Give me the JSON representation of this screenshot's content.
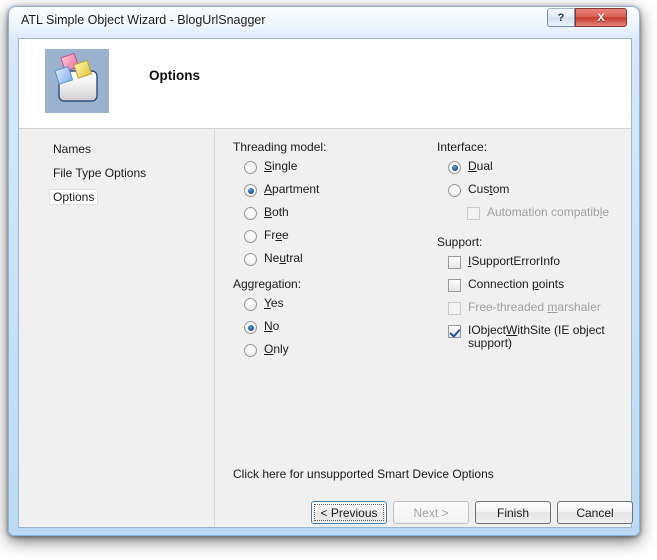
{
  "window": {
    "title": "ATL Simple Object Wizard - BlogUrlSnagger",
    "help_button": "?",
    "close_button": "X"
  },
  "header": {
    "title": "Options",
    "icon": "wizard-object-icon"
  },
  "sidebar": {
    "items": [
      {
        "label": "Names",
        "selected": false
      },
      {
        "label": "File Type Options",
        "selected": false
      },
      {
        "label": "Options",
        "selected": true
      }
    ]
  },
  "threading": {
    "group_label": "Threading model:",
    "options": [
      {
        "label": "Single",
        "acc": "S",
        "pre": "",
        "post": "ingle",
        "checked": false
      },
      {
        "label": "Apartment",
        "acc": "A",
        "pre": "",
        "post": "partment",
        "checked": true
      },
      {
        "label": "Both",
        "acc": "B",
        "pre": "",
        "post": "oth",
        "checked": false
      },
      {
        "label": "Free",
        "acc": "e",
        "pre": "Fr",
        "post": "e",
        "checked": false
      },
      {
        "label": "Neutral",
        "acc": "u",
        "pre": "Ne",
        "post": "tral",
        "checked": false
      }
    ]
  },
  "aggregation": {
    "group_label": "Aggregation:",
    "options": [
      {
        "label": "Yes",
        "acc": "Y",
        "pre": "",
        "post": "es",
        "checked": false
      },
      {
        "label": "No",
        "acc": "N",
        "pre": "",
        "post": "o",
        "checked": true
      },
      {
        "label": "Only",
        "acc": "O",
        "pre": "",
        "post": "nly",
        "checked": false
      }
    ]
  },
  "interface": {
    "group_label": "Interface:",
    "options": [
      {
        "label": "Dual",
        "acc": "D",
        "pre": "",
        "post": "ual",
        "checked": true
      },
      {
        "label": "Custom",
        "acc": "t",
        "pre": "Cus",
        "post": "om",
        "checked": false
      }
    ],
    "automation_compatible": {
      "label": "Automation compatible",
      "acc": "l",
      "pre": "Automation compatib",
      "post": "e",
      "checked": false,
      "disabled": true
    }
  },
  "support": {
    "group_label": "Support:",
    "options": [
      {
        "label": "ISupportErrorInfo",
        "acc": "I",
        "pre": "",
        "post": "SupportErrorInfo",
        "checked": false,
        "disabled": false
      },
      {
        "label": "Connection points",
        "acc": "p",
        "pre": "Connection ",
        "post": "oints",
        "checked": false,
        "disabled": false
      },
      {
        "label": "Free-threaded marshaler",
        "acc": "m",
        "pre": "Free-threaded ",
        "post": "arshaler",
        "checked": false,
        "disabled": true
      },
      {
        "label": "IObjectWithSite (IE object support)",
        "acc": "W",
        "pre": "IObject",
        "post": "ithSite (IE object support)",
        "checked": true,
        "disabled": false
      }
    ]
  },
  "smart_device_link": "Click here for unsupported Smart Device Options",
  "buttons": [
    {
      "label": "< Previous",
      "disabled": false,
      "focused": true,
      "name": "previous-button"
    },
    {
      "label": "Next >",
      "disabled": true,
      "focused": false,
      "name": "next-button"
    },
    {
      "label": "Finish",
      "disabled": false,
      "focused": false,
      "name": "finish-button"
    },
    {
      "label": "Cancel",
      "disabled": false,
      "focused": false,
      "name": "cancel-button"
    }
  ]
}
